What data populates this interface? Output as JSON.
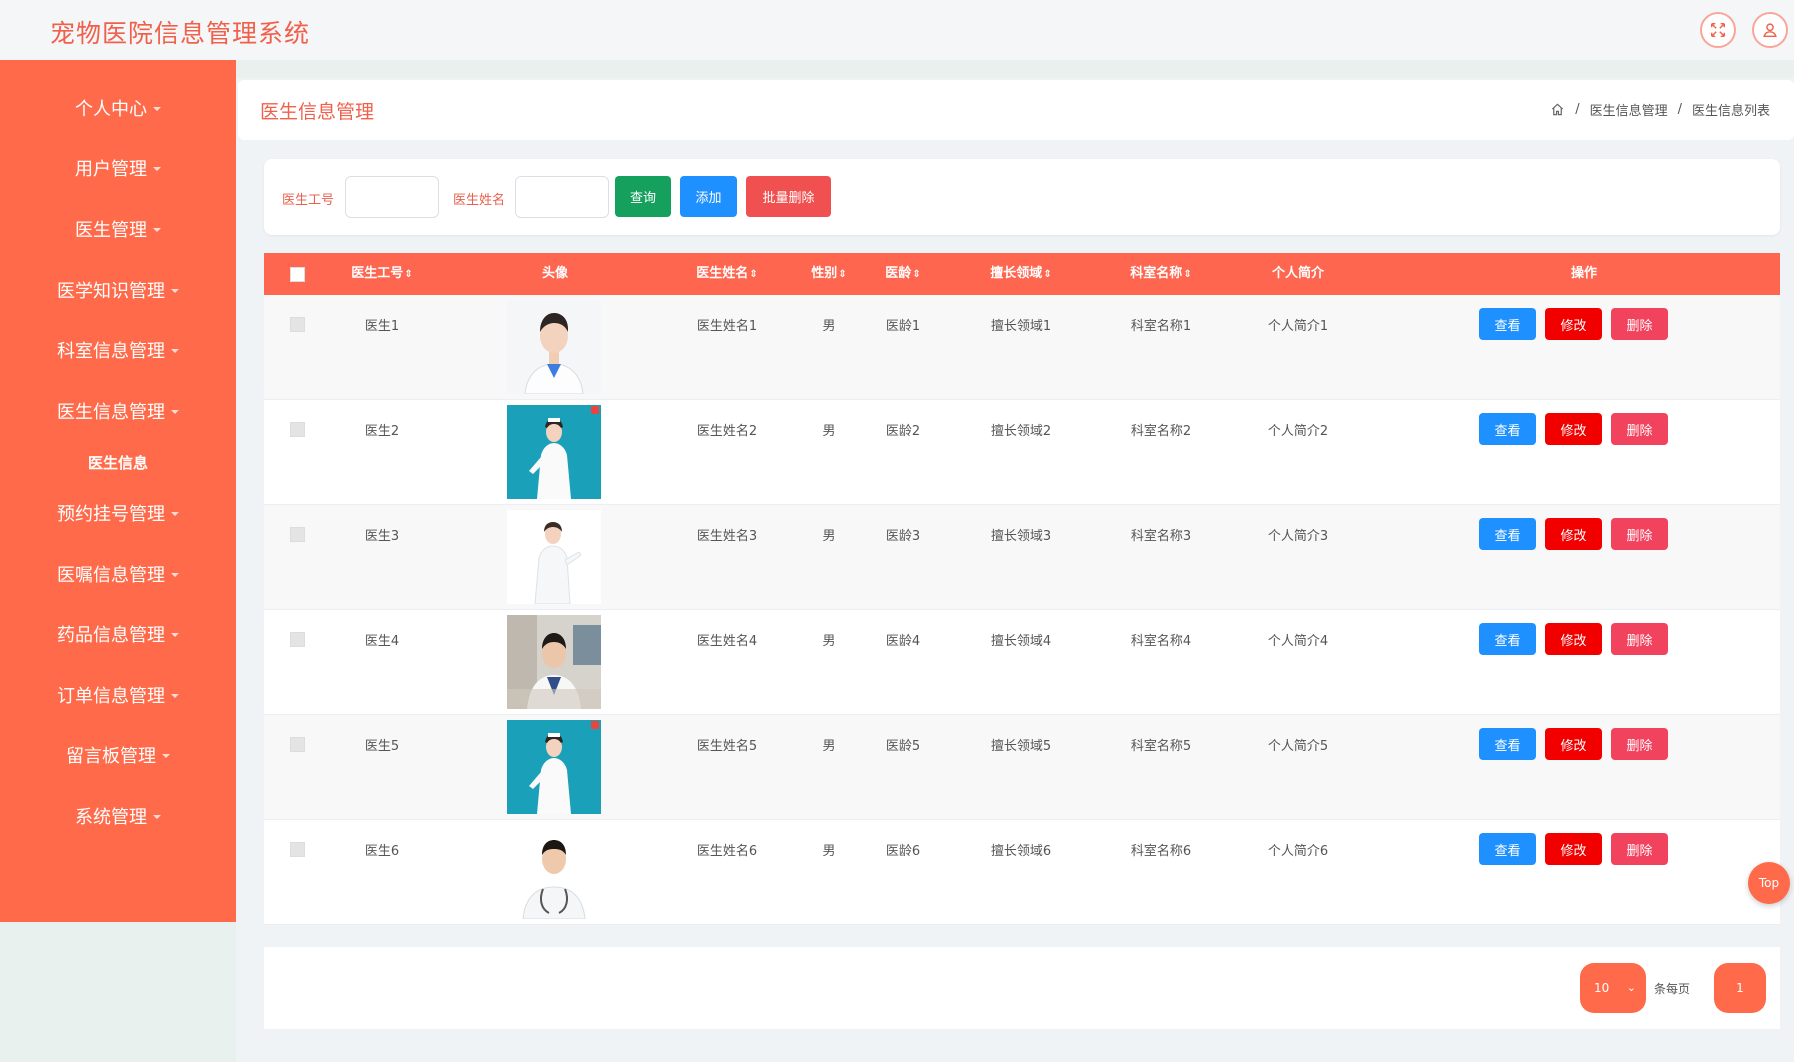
{
  "app": {
    "title": "宠物医院信息管理系统"
  },
  "topbar": {
    "icons": [
      "fullscreen-icon",
      "user-icon"
    ]
  },
  "sidebar": {
    "items": [
      {
        "label": "个人中心"
      },
      {
        "label": "用户管理"
      },
      {
        "label": "医生管理"
      },
      {
        "label": "医学知识管理"
      },
      {
        "label": "科室信息管理"
      },
      {
        "label": "医生信息管理"
      },
      {
        "label": "预约挂号管理"
      },
      {
        "label": "医嘱信息管理"
      },
      {
        "label": "药品信息管理"
      },
      {
        "label": "订单信息管理"
      },
      {
        "label": "留言板管理"
      },
      {
        "label": "系统管理"
      }
    ],
    "submenu": {
      "label": "医生信息"
    }
  },
  "header": {
    "title": "医生信息管理",
    "breadcrumb": [
      "医生信息管理",
      "医生信息列表"
    ]
  },
  "search": {
    "field1_label": "医生工号",
    "field1_value": "",
    "field2_label": "医生姓名",
    "field2_value": "",
    "query_label": "查询",
    "add_label": "添加",
    "batch_delete_label": "批量删除"
  },
  "table": {
    "columns": [
      "医生工号",
      "头像",
      "医生姓名",
      "性别",
      "医龄",
      "擅长领域",
      "科室名称",
      "个人简介",
      "操作"
    ],
    "rows": [
      {
        "id": "医生1",
        "name": "医生姓名1",
        "gender": "男",
        "years": "医龄1",
        "field": "擅长领域1",
        "dept": "科室名称1",
        "intro": "个人简介1"
      },
      {
        "id": "医生2",
        "name": "医生姓名2",
        "gender": "男",
        "years": "医龄2",
        "field": "擅长领域2",
        "dept": "科室名称2",
        "intro": "个人简介2"
      },
      {
        "id": "医生3",
        "name": "医生姓名3",
        "gender": "男",
        "years": "医龄3",
        "field": "擅长领域3",
        "dept": "科室名称3",
        "intro": "个人简介3"
      },
      {
        "id": "医生4",
        "name": "医生姓名4",
        "gender": "男",
        "years": "医龄4",
        "field": "擅长领域4",
        "dept": "科室名称4",
        "intro": "个人简介4"
      },
      {
        "id": "医生5",
        "name": "医生姓名5",
        "gender": "男",
        "years": "医龄5",
        "field": "擅长领域5",
        "dept": "科室名称5",
        "intro": "个人简介5"
      },
      {
        "id": "医生6",
        "name": "医生姓名6",
        "gender": "男",
        "years": "医龄6",
        "field": "擅长领域6",
        "dept": "科室名称6",
        "intro": "个人简介6"
      }
    ],
    "actions": {
      "view": "查看",
      "edit": "修改",
      "delete": "删除"
    }
  },
  "top_button": {
    "label": "Top"
  },
  "pagination": {
    "page_size": "10",
    "per_page_label": "条每页",
    "current_page": "1"
  },
  "colors": {
    "accent": "#ff6b4a",
    "table_header": "#ff6650",
    "query_button": "#16a05d",
    "add_button": "#1e90ff",
    "batch_delete_button": "#f05050",
    "view_button": "#1e90ff",
    "edit_button": "#f20000",
    "delete_button": "#f2435e"
  }
}
